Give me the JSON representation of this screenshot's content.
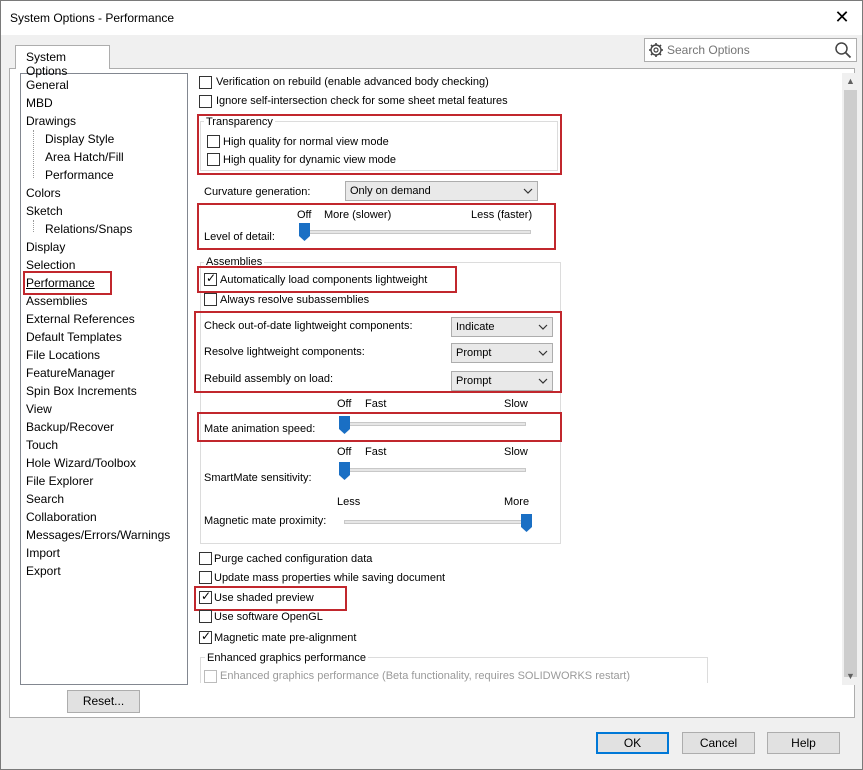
{
  "window": {
    "title": "System Options - Performance",
    "close_glyph": "✕"
  },
  "tabs": [
    {
      "label": "System Options"
    }
  ],
  "search": {
    "placeholder": "Search Options"
  },
  "tree": [
    {
      "label": "General",
      "level": 0
    },
    {
      "label": "MBD",
      "level": 0
    },
    {
      "label": "Drawings",
      "level": 0
    },
    {
      "label": "Display Style",
      "level": 1
    },
    {
      "label": "Area Hatch/Fill",
      "level": 1
    },
    {
      "label": "Performance",
      "level": 1
    },
    {
      "label": "Colors",
      "level": 0
    },
    {
      "label": "Sketch",
      "level": 0
    },
    {
      "label": "Relations/Snaps",
      "level": 1
    },
    {
      "label": "Display",
      "level": 0
    },
    {
      "label": "Selection",
      "level": 0
    },
    {
      "label": "Performance",
      "level": 0,
      "selected": true
    },
    {
      "label": "Assemblies",
      "level": 0
    },
    {
      "label": "External References",
      "level": 0
    },
    {
      "label": "Default Templates",
      "level": 0
    },
    {
      "label": "File Locations",
      "level": 0
    },
    {
      "label": "FeatureManager",
      "level": 0
    },
    {
      "label": "Spin Box Increments",
      "level": 0
    },
    {
      "label": "View",
      "level": 0
    },
    {
      "label": "Backup/Recover",
      "level": 0
    },
    {
      "label": "Touch",
      "level": 0
    },
    {
      "label": "Hole Wizard/Toolbox",
      "level": 0
    },
    {
      "label": "File Explorer",
      "level": 0
    },
    {
      "label": "Search",
      "level": 0
    },
    {
      "label": "Collaboration",
      "level": 0
    },
    {
      "label": "Messages/Errors/Warnings",
      "level": 0
    },
    {
      "label": "Import",
      "level": 0
    },
    {
      "label": "Export",
      "level": 0
    }
  ],
  "reset_label": "Reset...",
  "options": {
    "verification": {
      "label": "Verification on rebuild (enable advanced body checking)",
      "checked": false
    },
    "ignore_self_intersection": {
      "label": "Ignore self-intersection check for some sheet metal features",
      "checked": false
    },
    "transparency": {
      "title": "Transparency",
      "normal": {
        "label": "High quality for normal view mode",
        "checked": false
      },
      "dynamic": {
        "label": "High quality for dynamic view mode",
        "checked": false
      }
    },
    "curvature": {
      "label": "Curvature generation:",
      "value": "Only on demand"
    },
    "level_of_detail": {
      "label": "Level of detail:",
      "ticks": [
        "Off",
        "More (slower)",
        "Less (faster)"
      ],
      "value": 0.0
    },
    "assemblies": {
      "title": "Assemblies",
      "auto_load": {
        "label": "Automatically load components lightweight",
        "checked": true
      },
      "always_resolve": {
        "label": "Always resolve subassemblies",
        "checked": false
      },
      "check_outdated": {
        "label": "Check out-of-date lightweight components:",
        "value": "Indicate"
      },
      "resolve_lightweight": {
        "label": "Resolve lightweight components:",
        "value": "Prompt"
      },
      "rebuild_on_load": {
        "label": "Rebuild assembly on load:",
        "value": "Prompt"
      },
      "mate_animation": {
        "label": "Mate animation speed:",
        "ticks": [
          "Off",
          "Fast",
          "Slow"
        ],
        "value": 0.0
      },
      "smartmate": {
        "label": "SmartMate sensitivity:",
        "ticks": [
          "Off",
          "Fast",
          "Slow"
        ],
        "value": 0.0
      },
      "magnetic_proximity": {
        "label": "Magnetic mate proximity:",
        "ticks": [
          "Less",
          "More"
        ],
        "value": 1.0
      }
    },
    "purge_cached": {
      "label": "Purge cached configuration data",
      "checked": false
    },
    "update_mass": {
      "label": "Update mass properties while saving document",
      "checked": false
    },
    "shaded_preview": {
      "label": "Use shaded preview",
      "checked": true
    },
    "software_opengl": {
      "label": "Use software OpenGL",
      "checked": false
    },
    "magnetic_prealign": {
      "label": "Magnetic mate pre-alignment",
      "checked": true
    },
    "enhanced": {
      "title": "Enhanced graphics performance",
      "option": {
        "label": "Enhanced graphics performance (Beta functionality, requires SOLIDWORKS restart)",
        "checked": false,
        "disabled": true
      }
    }
  },
  "buttons": {
    "ok": "OK",
    "cancel": "Cancel",
    "help": "Help"
  },
  "colors": {
    "highlight": "#c1272d",
    "slider_thumb": "#1a6fc4",
    "default_button_border": "#0078d7"
  }
}
